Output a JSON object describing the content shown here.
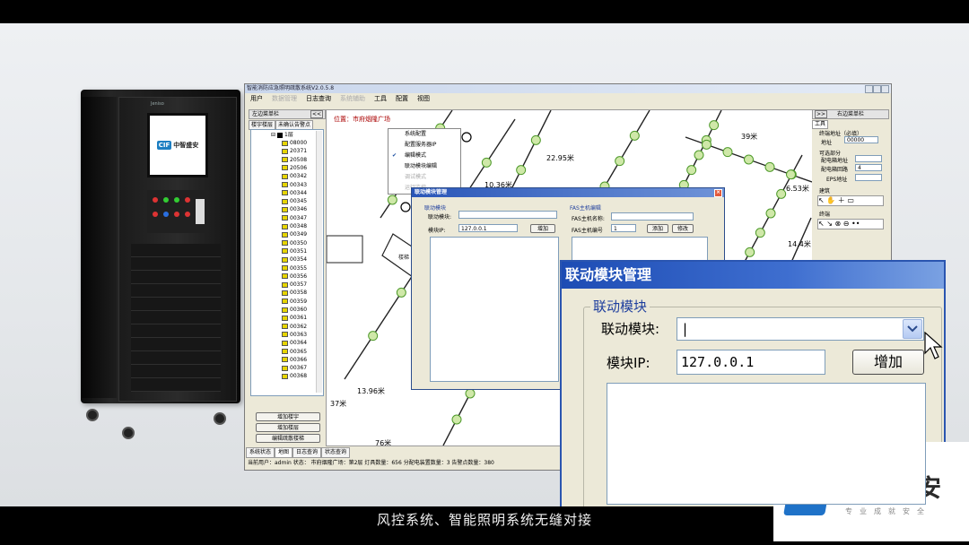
{
  "subtitle": "风控系统、智能照明系统无缝对接",
  "brand": {
    "badge": "CIF",
    "name": "中智盛安",
    "slogan": "专业成就安全",
    "color": "#1f72c8"
  },
  "cabinet": {
    "top_label": "Jeniso",
    "screen_badge": "CIF",
    "screen_name": "中智盛安"
  },
  "app": {
    "title": "智能消防应急照明疏散系统V2.0.5.8",
    "menu": [
      "用户",
      "数据管理",
      "日志查询",
      "系统辅助",
      "工具",
      "配置",
      "视图"
    ],
    "menu_disabled": [
      1,
      3
    ],
    "left_panel": {
      "title": "左边菜单栏",
      "collapse": "<<",
      "tabs": [
        "楼宇楼层",
        "未确认告警点"
      ],
      "root": "1层",
      "items": [
        "08000",
        "20371",
        "20508",
        "20506",
        "00342",
        "00343",
        "00344",
        "00345",
        "00346",
        "00347",
        "00348",
        "00349",
        "00350",
        "00351",
        "00354",
        "00355",
        "00356",
        "00357",
        "00358",
        "00359",
        "00360",
        "00361",
        "00362",
        "00363",
        "00364",
        "00365",
        "00366",
        "00367",
        "00368"
      ],
      "buttons": [
        "增加楼宇",
        "增加楼层",
        "编辑疏散楼梯"
      ]
    },
    "map": {
      "position_label": "位置：",
      "position_value": "市府烟隆广场",
      "distances": [
        "22.95米",
        "10.36米",
        "13.96米",
        "37米",
        "76米",
        "39米",
        "6.53米",
        "14.4米"
      ],
      "building": "楼梯"
    },
    "right_panel": {
      "expand": ">>",
      "title": "右边菜单栏",
      "tab": "工具",
      "terminal_addr_label": "终端地址（必填）",
      "addr_label": "地址",
      "addr_value": "00000",
      "optional_label": "可选部分",
      "dist_box_label": "配电箱地址",
      "loop_label": "配电箱回路",
      "loop_value": "4",
      "eps_label": "EPS地址",
      "building_section": "建筑",
      "terminal_section": "终端"
    },
    "dropdown": {
      "items": [
        "系统配置",
        "配置服务器IP",
        "编辑模式",
        "联动模块编辑",
        "调试模式",
        "运行监控"
      ],
      "checked": 2,
      "disabled": [
        4,
        5
      ]
    },
    "status_tabs": [
      "系统状态",
      "地图",
      "日志查询",
      "状态查询"
    ],
    "status_bar": "当前用户：admin  状态：  市府烟隆广场：第2层  灯具数量：656  分配电装置数量：3  告警点数量：380"
  },
  "small_dialog": {
    "title": "联动模块管理",
    "group": "联动模块",
    "module_label": "联动模块:",
    "ip_label": "模块IP:",
    "ip_value": "127.0.0.1",
    "add": "增加",
    "fas_group": "FAS主机编辑",
    "fas_name_label": "FAS主机名称:",
    "fas_no_label": "FAS主机编号",
    "fas_no_value": "1",
    "fas_add": "添加",
    "fas_edit": "修改"
  },
  "zoom_dialog": {
    "title": "联动模块管理",
    "group": "联动模块",
    "module_label": "联动模块:",
    "module_value": "|",
    "ip_label": "模块IP:",
    "ip_value": "127.0.0.1",
    "add": "增加"
  }
}
